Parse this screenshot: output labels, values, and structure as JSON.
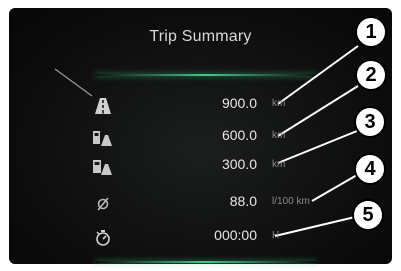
{
  "screen": {
    "title": "Trip Summary"
  },
  "rows": [
    {
      "icon": "road-distance-icon",
      "value": "900.0",
      "unit": "km"
    },
    {
      "icon": "fuel-range-icon",
      "value": "600.0",
      "unit": "km"
    },
    {
      "icon": "fuel-range-alt-icon",
      "value": "300.0",
      "unit": "km"
    },
    {
      "icon": "average-diameter-icon",
      "value": "88.0",
      "unit": "l/100 km"
    },
    {
      "icon": "stopwatch-icon",
      "value": "000:00",
      "unit": "H"
    }
  ],
  "callouts": [
    "1",
    "2",
    "3",
    "4",
    "5"
  ],
  "colors": {
    "accent_glow": "#50e6a0",
    "background": "#0b0c0b",
    "text": "#e6e6e6"
  }
}
